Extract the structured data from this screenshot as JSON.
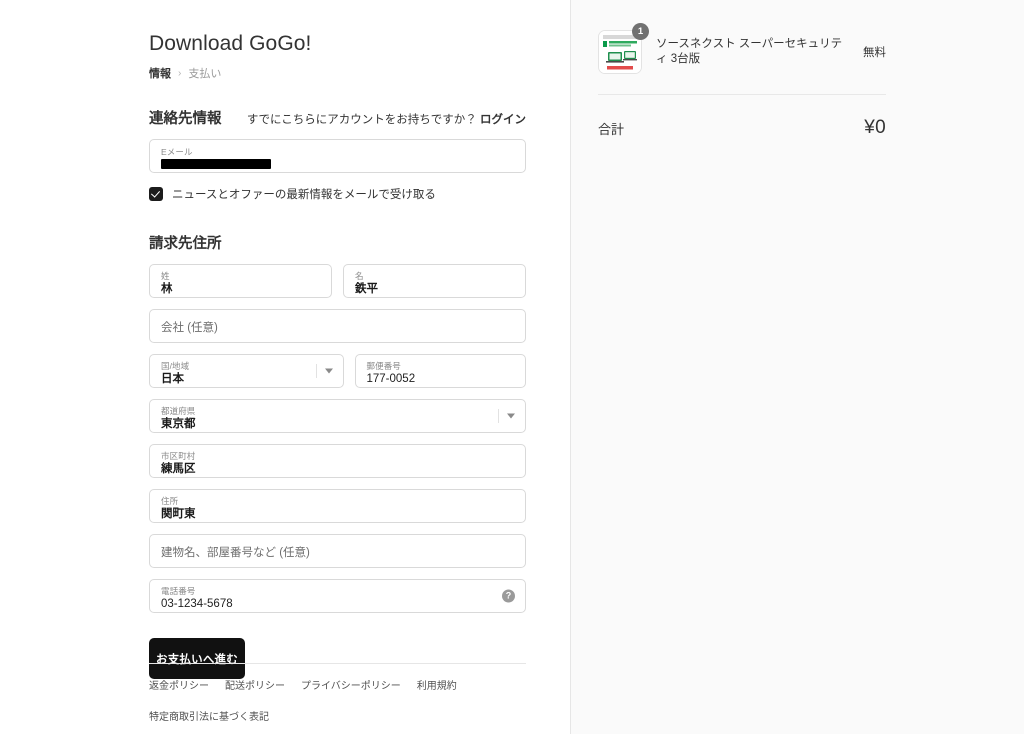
{
  "shop": {
    "title": "Download GoGo!"
  },
  "breadcrumb": {
    "current": "情報",
    "separator": "›",
    "next": "支払い"
  },
  "contact": {
    "section_title": "連絡先情報",
    "login_prompt": "すでにこちらにアカウントをお持ちですか？",
    "login_link": "ログイン",
    "email_label": "Eメール",
    "email_value_redacted": true,
    "newsletter_label": "ニュースとオファーの最新情報をメールで受け取る",
    "newsletter_checked": true
  },
  "billing": {
    "section_title": "請求先住所",
    "fields": {
      "last_name": {
        "label": "姓",
        "value": "林"
      },
      "first_name": {
        "label": "名",
        "value": "鉄平"
      },
      "company": {
        "label": "",
        "placeholder": "会社 (任意)",
        "value": ""
      },
      "country": {
        "label": "国/地域",
        "value": "日本"
      },
      "postal_code": {
        "label": "郵便番号",
        "value": "177-0052"
      },
      "prefecture": {
        "label": "都道府県",
        "value": "東京都"
      },
      "city": {
        "label": "市区町村",
        "value": "練馬区"
      },
      "address1": {
        "label": "住所",
        "value": "関町東"
      },
      "address2": {
        "label": "",
        "placeholder": "建物名、部屋番号など (任意)",
        "value": ""
      },
      "phone": {
        "label": "電話番号",
        "value": "03-1234-5678",
        "help_icon": "?"
      }
    },
    "submit_label": "お支払いへ進む"
  },
  "footer": {
    "links": [
      "返金ポリシー",
      "配送ポリシー",
      "プライバシーポリシー",
      "利用規約",
      "特定商取引法に基づく表記"
    ]
  },
  "summary": {
    "items": [
      {
        "name": "ソースネクスト スーパーセキュリティ 3台版",
        "price": "無料",
        "quantity": "1"
      }
    ],
    "total_label": "合計",
    "total_value": "¥0"
  },
  "colors": {
    "accent_button": "#111111",
    "panel_background": "#fafafa",
    "border": "#d9d9d9",
    "badge": "#717171"
  }
}
